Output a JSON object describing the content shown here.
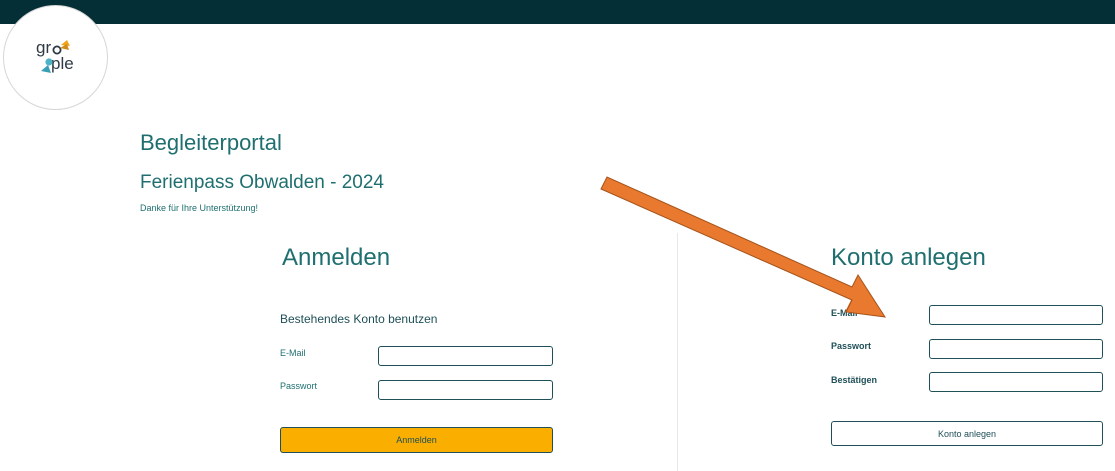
{
  "brand": {
    "logo_text": "gro  ple"
  },
  "header": {
    "portal_title": "Begleiterportal",
    "event_title": "Ferienpass Obwalden - 2024",
    "thanks": "Danke für Ihre Unterstützung!"
  },
  "login": {
    "heading": "Anmelden",
    "subheading": "Bestehendes Konto benutzen",
    "email_label": "E-Mail",
    "email_value": "",
    "password_label": "Passwort",
    "password_value": "",
    "button_label": "Anmelden"
  },
  "register": {
    "heading": "Konto anlegen",
    "email_label": "E-Mail",
    "email_value": "",
    "password_label": "Passwort",
    "password_value": "",
    "confirm_label": "Bestätigen",
    "confirm_value": "",
    "button_label": "Konto anlegen"
  },
  "colors": {
    "topbar": "#042f36",
    "accent": "#1f6f70",
    "login_button": "#f9ae00",
    "annotation_arrow": "#e8792e"
  },
  "icons": {
    "logo": "groople-logo-icon",
    "annotation": "annotation-arrow-icon"
  }
}
